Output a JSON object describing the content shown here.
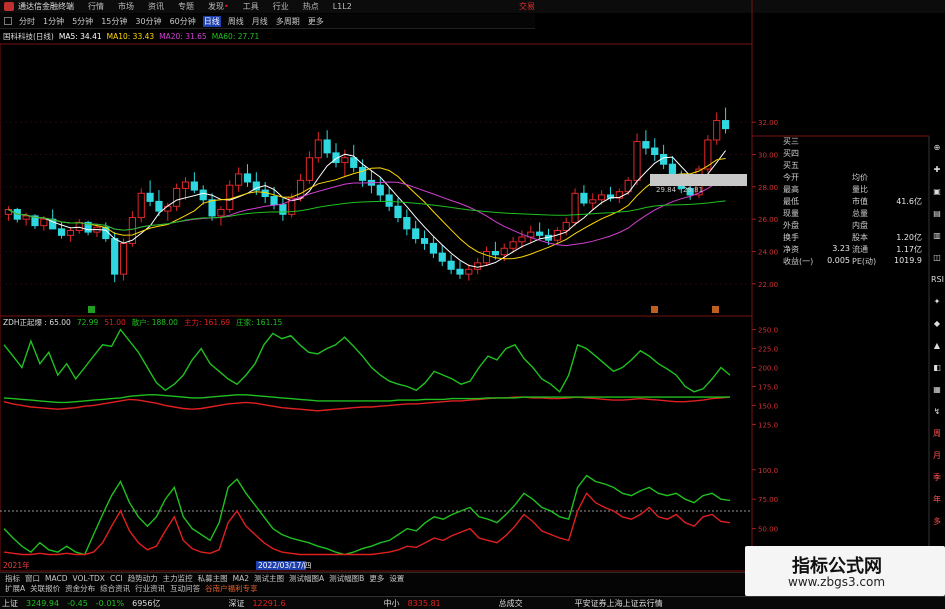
{
  "titlebar": {
    "app_title": "通达信金融终端",
    "menus": [
      "行情",
      "市场",
      "资讯",
      "专题",
      "发现",
      "工具",
      "行业",
      "热点",
      "L1L2"
    ],
    "trade_label": "交易"
  },
  "periodbar": {
    "tabs": [
      "分时",
      "1分钟",
      "5分钟",
      "15分钟",
      "30分钟",
      "60分钟",
      "日线",
      "周线",
      "月线",
      "多周期",
      "更多"
    ],
    "active": "日线"
  },
  "ma_legend": {
    "stock": "国科科技(日线)",
    "ma5": "MA5: 34.41",
    "ma10": "MA10: 33.43",
    "ma20": "MA20: 31.65",
    "ma60": "MA60: 27.71",
    "colors": {
      "stock": "#dddddd",
      "ma5": "#ffffff",
      "ma10": "#ffd800",
      "ma20": "#d040d0",
      "ma60": "#20c020"
    }
  },
  "price_axis": {
    "labels": [
      "32.00",
      "30.00",
      "28.00",
      "26.00",
      "24.00",
      "22.00"
    ]
  },
  "price_tag": "29.84 - 29.81",
  "info_panel": {
    "rows": [
      {
        "label": "买三",
        "mid": "",
        "key": "",
        "val": ""
      },
      {
        "label": "买四",
        "mid": "",
        "key": "",
        "val": ""
      },
      {
        "label": "买五",
        "mid": "",
        "key": "",
        "val": ""
      },
      {
        "label": "今开",
        "mid": "",
        "key": "均价",
        "val": ""
      },
      {
        "label": "最高",
        "mid": "",
        "key": "量比",
        "val": ""
      },
      {
        "label": "最低",
        "mid": "",
        "key": "市值",
        "val": "41.6亿"
      },
      {
        "label": "现量",
        "mid": "",
        "key": "总量",
        "val": ""
      },
      {
        "label": "外盘",
        "mid": "",
        "key": "内盘",
        "val": ""
      },
      {
        "label": "换手",
        "mid": "",
        "key": "股本",
        "val": "1.20亿"
      },
      {
        "label": "净资",
        "mid": "3.23",
        "key": "流通",
        "val": "1.17亿"
      },
      {
        "label": "收益(一)",
        "mid": "0.005",
        "key": "PE(动)",
        "val": "1019.9"
      }
    ]
  },
  "icon_strip": [
    "⊕",
    "✚",
    "▣",
    "▤",
    "▥",
    "◫",
    "RSI",
    "✦",
    "◆",
    "▲",
    "◧",
    "▦",
    "↯",
    "周",
    "月",
    "季",
    "年",
    "多"
  ],
  "indicator_header": {
    "name": "ZDH正起爆 : 65.00",
    "v1": "72.99",
    "v2": "51.00",
    "v3": "散户: 188.00",
    "v4": "主力: 161.69",
    "v5": "庄家: 161.15",
    "colors": {
      "v1": "#20c020",
      "v2": "#e02020",
      "v3": "#20c020",
      "v4": "#e02020",
      "v5": "#20c020"
    }
  },
  "ind_axis1": [
    "250.0",
    "225.0",
    "200.0",
    "175.0",
    "150.0",
    "125.0"
  ],
  "ind_axis2": [
    "100.0",
    "75.00",
    "50.00"
  ],
  "date_axis": {
    "start": "2021年",
    "cursor": "2022/03/17/四"
  },
  "bottom_tabs": [
    "指标",
    "窗口",
    "MACD",
    "VOL-TDX",
    "CCI",
    "趋势动力",
    "主力监控",
    "私募主图",
    "MA2",
    "测试主图",
    "测试幅图A",
    "测试幅图B",
    "更多",
    "设置"
  ],
  "sub_tabs": [
    "扩展A",
    "关联报价",
    "资金分布",
    "综合资讯",
    "行业资讯",
    "互动问答",
    "谷南户福利专享"
  ],
  "status_bar": {
    "sh_label": "上证",
    "sh_value": "3249.94",
    "sh_change": "-0.45",
    "sh_pct": "-0.01%",
    "sh_amount": "6956亿",
    "sz_label": "深证",
    "sz_value": "12291.6",
    "zx_label": "中小",
    "zx_value": "8335.81",
    "cy_label": "总成交",
    "right_text": "平安证券上海上证云行情",
    "colors": {
      "up": "#e02020",
      "down": "#20c020"
    }
  },
  "watermark": {
    "title": "指标公式网",
    "url": "www.zbgs3.com"
  },
  "chart_data": [
    {
      "type": "candlestick",
      "title": "国科科技(日线)",
      "ylim": [
        21,
        33
      ],
      "candles": [
        [
          26.3,
          26.8,
          25.9,
          26.6
        ],
        [
          26.6,
          26.7,
          25.8,
          26.0
        ],
        [
          26.0,
          26.4,
          25.6,
          26.2
        ],
        [
          26.2,
          26.3,
          25.4,
          25.6
        ],
        [
          25.6,
          26.2,
          25.3,
          26.0
        ],
        [
          26.0,
          26.6,
          25.8,
          25.4
        ],
        [
          25.4,
          25.8,
          24.8,
          25.0
        ],
        [
          25.0,
          25.5,
          24.6,
          25.3
        ],
        [
          25.3,
          26.0,
          25.1,
          25.8
        ],
        [
          25.8,
          25.9,
          25.0,
          25.2
        ],
        [
          25.2,
          25.7,
          24.9,
          25.5
        ],
        [
          25.5,
          25.8,
          24.6,
          24.8
        ],
        [
          24.8,
          25.2,
          22.1,
          22.6
        ],
        [
          22.6,
          24.8,
          22.2,
          24.5
        ],
        [
          24.5,
          26.5,
          24.3,
          26.1
        ],
        [
          26.1,
          27.9,
          25.8,
          27.6
        ],
        [
          27.6,
          28.4,
          26.8,
          27.1
        ],
        [
          27.1,
          27.8,
          26.2,
          26.5
        ],
        [
          26.5,
          27.0,
          25.9,
          26.8
        ],
        [
          26.8,
          28.2,
          26.5,
          27.9
        ],
        [
          27.9,
          28.6,
          27.2,
          28.3
        ],
        [
          28.3,
          28.9,
          27.6,
          27.8
        ],
        [
          27.8,
          28.1,
          26.9,
          27.2
        ],
        [
          27.2,
          27.6,
          25.9,
          26.2
        ],
        [
          26.2,
          26.8,
          25.6,
          26.6
        ],
        [
          26.6,
          28.4,
          26.4,
          28.1
        ],
        [
          28.1,
          29.2,
          27.7,
          28.8
        ],
        [
          28.8,
          29.4,
          28.0,
          28.3
        ],
        [
          28.3,
          28.9,
          27.5,
          27.8
        ],
        [
          27.8,
          28.3,
          27.0,
          27.4
        ],
        [
          27.4,
          28.0,
          26.6,
          26.9
        ],
        [
          26.9,
          27.3,
          25.9,
          26.3
        ],
        [
          26.3,
          27.6,
          26.1,
          27.3
        ],
        [
          27.3,
          28.8,
          27.1,
          28.4
        ],
        [
          28.4,
          30.2,
          28.2,
          29.8
        ],
        [
          29.8,
          31.4,
          29.5,
          30.9
        ],
        [
          30.9,
          31.5,
          29.8,
          30.1
        ],
        [
          30.1,
          30.7,
          29.2,
          29.5
        ],
        [
          29.5,
          30.3,
          28.6,
          29.8
        ],
        [
          29.8,
          30.6,
          28.9,
          29.2
        ],
        [
          29.2,
          29.7,
          28.0,
          28.4
        ],
        [
          28.4,
          29.0,
          27.6,
          28.1
        ],
        [
          28.1,
          28.6,
          27.1,
          27.5
        ],
        [
          27.5,
          28.0,
          26.5,
          26.8
        ],
        [
          26.8,
          27.3,
          25.8,
          26.1
        ],
        [
          26.1,
          26.6,
          25.0,
          25.4
        ],
        [
          25.4,
          25.9,
          24.5,
          24.8
        ],
        [
          24.8,
          25.3,
          24.1,
          24.5
        ],
        [
          24.5,
          24.9,
          23.6,
          23.9
        ],
        [
          23.9,
          24.4,
          23.1,
          23.4
        ],
        [
          23.4,
          23.8,
          22.6,
          22.9
        ],
        [
          22.9,
          23.4,
          22.3,
          22.6
        ],
        [
          22.6,
          23.2,
          22.2,
          22.9
        ],
        [
          22.9,
          23.6,
          22.6,
          23.3
        ],
        [
          23.3,
          24.3,
          23.1,
          24.0
        ],
        [
          24.0,
          24.6,
          23.5,
          23.8
        ],
        [
          23.8,
          24.5,
          23.4,
          24.2
        ],
        [
          24.2,
          24.9,
          23.9,
          24.6
        ],
        [
          24.6,
          25.3,
          24.2,
          24.9
        ],
        [
          24.9,
          25.6,
          24.5,
          25.2
        ],
        [
          25.2,
          25.8,
          24.8,
          25.0
        ],
        [
          25.0,
          25.4,
          24.4,
          24.7
        ],
        [
          24.7,
          25.5,
          24.5,
          25.3
        ],
        [
          25.3,
          26.1,
          25.0,
          25.8
        ],
        [
          25.8,
          27.9,
          25.6,
          27.6
        ],
        [
          27.6,
          28.1,
          26.8,
          27.0
        ],
        [
          27.0,
          27.6,
          26.6,
          27.2
        ],
        [
          27.2,
          27.8,
          26.9,
          27.5
        ],
        [
          27.5,
          28.0,
          27.1,
          27.3
        ],
        [
          27.3,
          27.9,
          27.0,
          27.7
        ],
        [
          27.7,
          28.6,
          27.5,
          28.4
        ],
        [
          28.4,
          31.3,
          28.1,
          30.8
        ],
        [
          30.8,
          31.5,
          30.0,
          30.4
        ],
        [
          30.4,
          31.0,
          29.6,
          30.0
        ],
        [
          30.0,
          30.6,
          29.1,
          29.4
        ],
        [
          29.4,
          29.9,
          28.3,
          28.6
        ],
        [
          28.6,
          29.0,
          27.6,
          27.9
        ],
        [
          27.9,
          28.3,
          27.2,
          27.5
        ],
        [
          27.5,
          29.3,
          27.3,
          29.1
        ],
        [
          29.1,
          31.2,
          28.9,
          30.9
        ],
        [
          30.9,
          32.6,
          30.6,
          32.1
        ],
        [
          32.1,
          32.9,
          31.3,
          31.6
        ]
      ]
    },
    {
      "type": "line",
      "title": "ZDH正起爆",
      "ylim": [
        115,
        260
      ],
      "series": [
        {
          "name": "散户",
          "color": "#20c020",
          "values": [
            230,
            215,
            200,
            235,
            205,
            220,
            190,
            205,
            185,
            200,
            215,
            230,
            228,
            250,
            235,
            220,
            200,
            180,
            170,
            178,
            190,
            210,
            225,
            205,
            195,
            185,
            178,
            190,
            205,
            230,
            245,
            238,
            242,
            230,
            220,
            218,
            225,
            230,
            240,
            228,
            215,
            200,
            190,
            182,
            178,
            175,
            170,
            180,
            195,
            190,
            185,
            178,
            182,
            200,
            215,
            210,
            225,
            230,
            212,
            200,
            185,
            178,
            168,
            190,
            230,
            225,
            215,
            205,
            195,
            200,
            210,
            222,
            215,
            205,
            198,
            190,
            175,
            168,
            172,
            185,
            200,
            190
          ]
        },
        {
          "name": "主力",
          "color": "#e02020",
          "values": [
            155,
            152,
            150,
            148,
            147,
            146,
            145,
            146,
            147,
            149,
            150,
            152,
            154,
            156,
            158,
            157,
            155,
            153,
            150,
            148,
            146,
            145,
            146,
            148,
            150,
            152,
            153,
            154,
            153,
            151,
            149,
            147,
            146,
            145,
            144,
            143,
            144,
            145,
            146,
            147,
            148,
            148,
            149,
            150,
            151,
            152,
            152,
            153,
            154,
            155,
            156,
            156,
            157,
            158,
            159,
            160,
            160,
            161,
            161,
            160,
            160,
            159,
            159,
            160,
            161,
            160,
            159,
            158,
            157,
            157,
            158,
            159,
            158,
            157,
            156,
            155,
            155,
            156,
            157,
            159,
            160,
            161
          ]
        },
        {
          "name": "庄家",
          "color": "#20c020",
          "values": [
            160,
            159,
            158,
            157,
            156,
            155,
            154,
            154,
            155,
            156,
            157,
            158,
            159,
            160,
            162,
            163,
            164,
            164,
            163,
            162,
            161,
            160,
            160,
            161,
            162,
            163,
            164,
            164,
            163,
            162,
            161,
            160,
            159,
            158,
            157,
            156,
            156,
            156,
            156,
            156,
            156,
            156,
            156,
            156,
            157,
            157,
            157,
            158,
            158,
            158,
            159,
            159,
            159,
            159,
            160,
            160,
            160,
            160,
            161,
            161,
            161,
            161,
            161,
            161,
            161,
            161,
            161,
            161,
            161,
            161,
            161,
            161,
            161,
            161,
            161,
            161,
            161,
            161,
            161,
            161,
            161,
            161
          ]
        }
      ]
    },
    {
      "type": "line",
      "title": "ZDH正起爆 lower",
      "ylim": [
        25,
        110
      ],
      "reference_line": 65,
      "series": [
        {
          "name": "绿线",
          "color": "#20c020",
          "values": [
            50,
            42,
            35,
            30,
            38,
            32,
            30,
            35,
            30,
            28,
            45,
            62,
            78,
            90,
            72,
            60,
            52,
            60,
            75,
            85,
            60,
            50,
            45,
            40,
            55,
            85,
            92,
            80,
            70,
            60,
            50,
            45,
            42,
            40,
            38,
            35,
            33,
            30,
            28,
            30,
            33,
            35,
            38,
            40,
            45,
            50,
            48,
            55,
            60,
            58,
            62,
            65,
            68,
            60,
            58,
            55,
            62,
            70,
            80,
            75,
            68,
            65,
            60,
            58,
            85,
            95,
            90,
            88,
            85,
            80,
            78,
            82,
            85,
            80,
            78,
            80,
            75,
            72,
            78,
            80,
            75,
            74
          ]
        },
        {
          "name": "红线",
          "color": "#e02020",
          "values": [
            30,
            29,
            28,
            28,
            29,
            28,
            28,
            29,
            28,
            28,
            30,
            38,
            52,
            65,
            48,
            38,
            32,
            35,
            48,
            60,
            40,
            33,
            30,
            29,
            32,
            55,
            65,
            52,
            45,
            38,
            33,
            30,
            29,
            28,
            28,
            28,
            28,
            28,
            28,
            28,
            28,
            28,
            29,
            30,
            32,
            35,
            34,
            38,
            42,
            40,
            44,
            47,
            50,
            42,
            40,
            38,
            44,
            52,
            62,
            56,
            48,
            45,
            42,
            40,
            65,
            80,
            72,
            68,
            65,
            60,
            58,
            62,
            68,
            60,
            58,
            62,
            55,
            52,
            60,
            62,
            56,
            55
          ]
        }
      ]
    }
  ]
}
